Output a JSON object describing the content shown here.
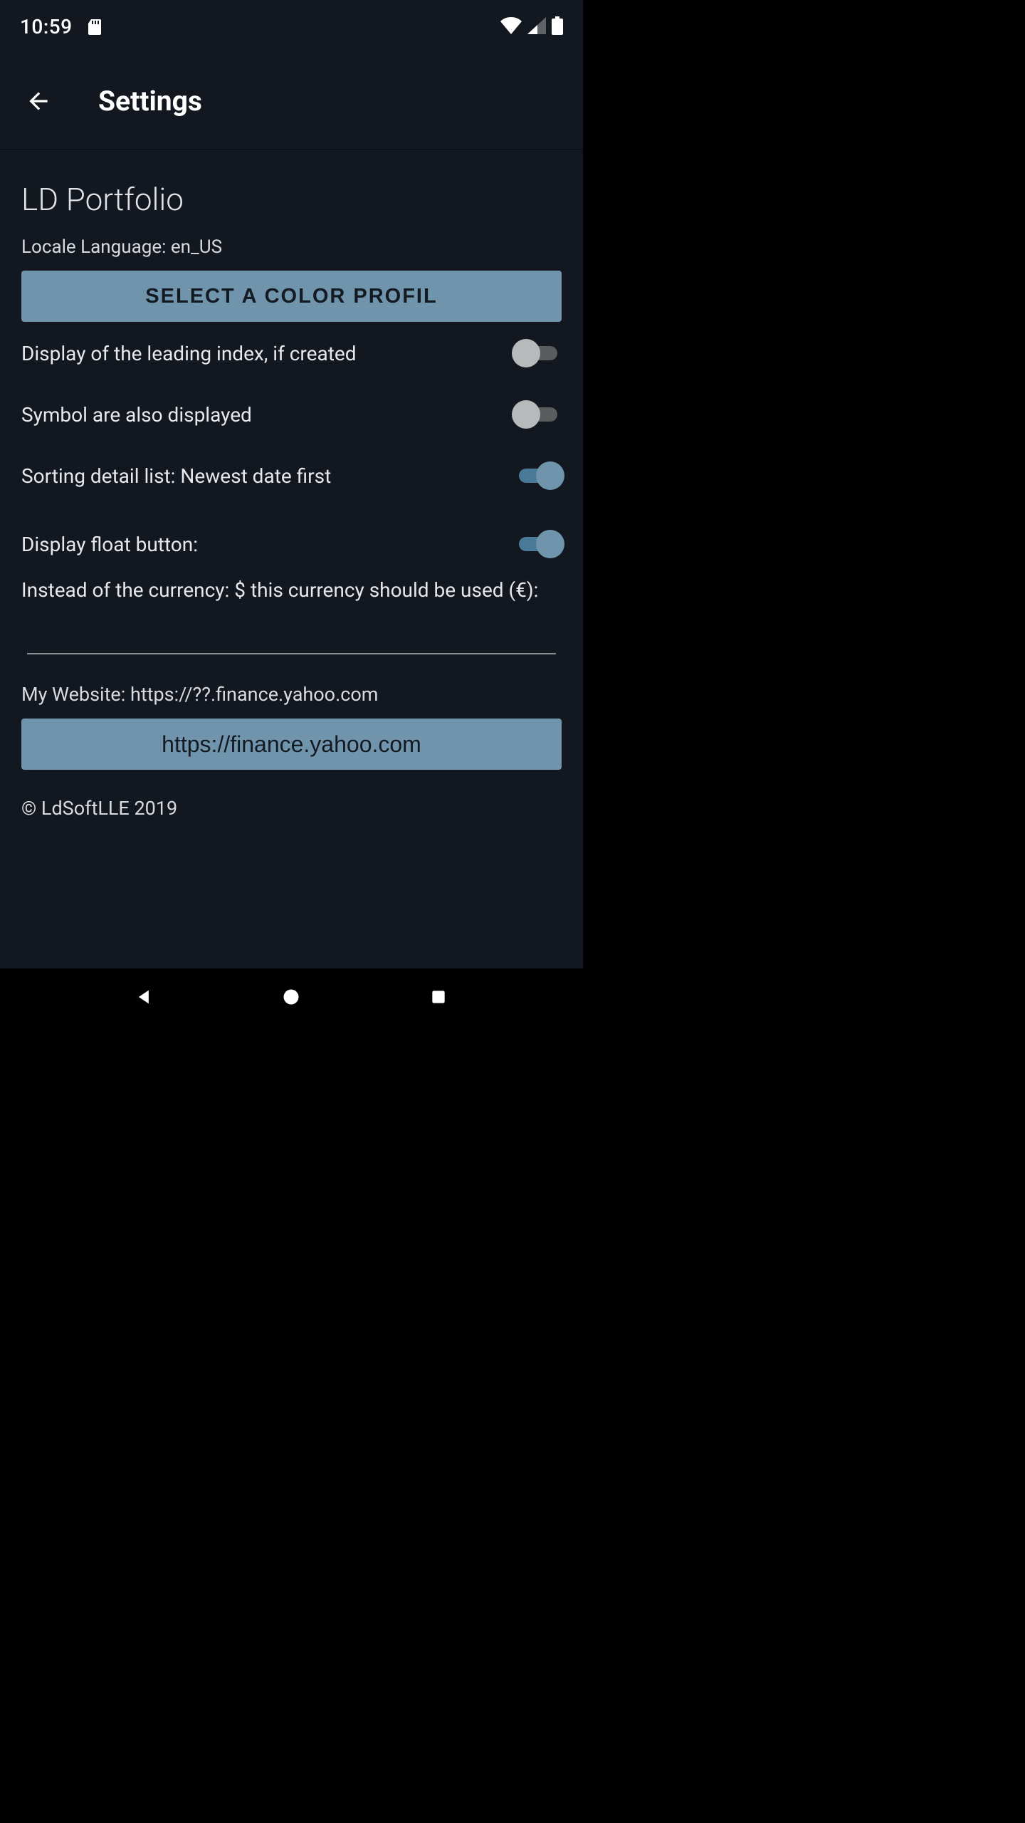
{
  "status": {
    "time": "10:59"
  },
  "appbar": {
    "title": "Settings"
  },
  "section_title": "LD Portfolio",
  "locale_label": "Locale Language:  en_US",
  "color_profile_button": "SELECT A COLOR PROFIL",
  "rows": {
    "leading_index": {
      "label": "Display of the leading index, if created",
      "on": false
    },
    "symbol": {
      "label": "Symbol are also displayed",
      "on": false
    },
    "sort": {
      "label": "Sorting detail list: Newest date first",
      "on": true
    },
    "float_button": {
      "label": "Display float button:",
      "on": true
    }
  },
  "currency_label": "Instead of the currency: $  this currency should be used (€):",
  "currency_value": "",
  "website_label": "My Website: https://??.finance.yahoo.com",
  "website_button": "https://finance.yahoo.com",
  "copyright": "© LdSoftLLE 2019"
}
